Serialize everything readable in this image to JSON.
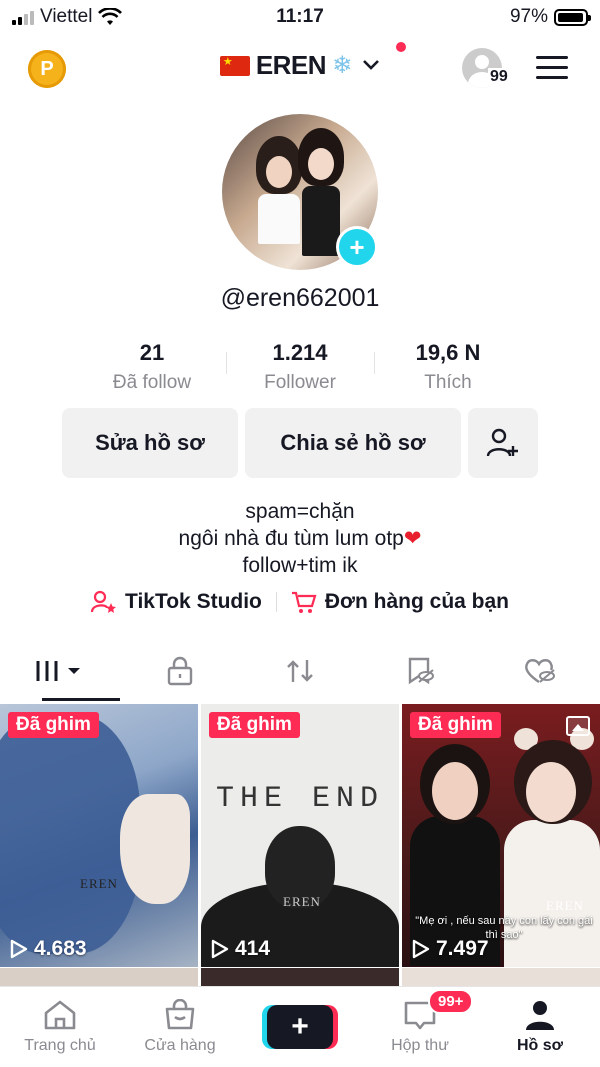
{
  "status_bar": {
    "carrier": "Viettel",
    "time": "11:17",
    "battery": "97%",
    "battery_level": 0.97
  },
  "header": {
    "username_display": "EREN",
    "visitor_count": "99",
    "coin_letter": "P"
  },
  "profile": {
    "handle": "@eren662001",
    "stats": [
      {
        "value": "21",
        "label": "Đã follow"
      },
      {
        "value": "1.214",
        "label": "Follower"
      },
      {
        "value": "19,6 N",
        "label": "Thích"
      }
    ],
    "buttons": {
      "edit": "Sửa hồ sơ",
      "share": "Chia sẻ hồ sơ"
    },
    "bio": [
      "spam=chặn",
      "ngôi nhà đu tùm lum otp",
      "follow+tim ik"
    ],
    "links": {
      "studio": "TikTok Studio",
      "orders": "Đơn hàng của bạn"
    }
  },
  "tabs": [
    "videos-grid",
    "private-lock",
    "reposts",
    "favorites",
    "liked"
  ],
  "videos": [
    {
      "pinned": "Đã ghim",
      "views": "4.683",
      "watermark": "EREN"
    },
    {
      "pinned": "Đã ghim",
      "views": "414",
      "watermark": "EREN",
      "title_text": "THE END"
    },
    {
      "pinned": "Đã ghim",
      "views": "7.497",
      "watermark": "EREN",
      "caption": "\"Mẹ ơi , nếu sau này con lấy con gái thì sao\""
    }
  ],
  "navbar": {
    "home": "Trang chủ",
    "shop": "Cửa hàng",
    "inbox": "Hộp thư",
    "inbox_badge": "99+",
    "profile": "Hồ sơ"
  },
  "colors": {
    "accent": "#fe2c55",
    "cyan": "#20d5ec",
    "text": "#161823",
    "muted": "#8a8b91"
  }
}
